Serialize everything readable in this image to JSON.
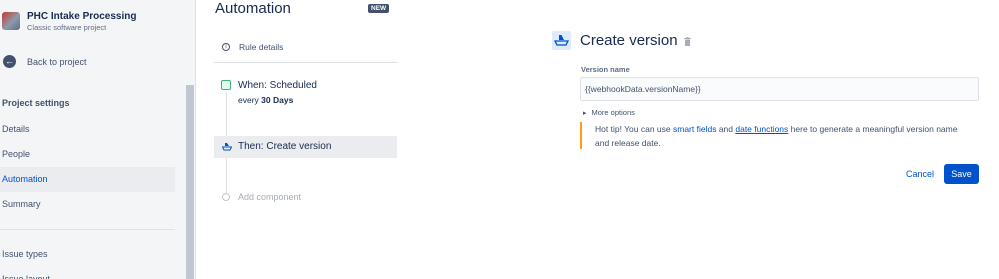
{
  "project": {
    "name": "PHC Intake Processing",
    "type": "Classic software project"
  },
  "sidebar": {
    "back_label": "Back to project",
    "section_title": "Project settings",
    "items": [
      {
        "label": "Details"
      },
      {
        "label": "People"
      },
      {
        "label": "Automation"
      },
      {
        "label": "Summary"
      },
      {
        "label": "Issue types"
      },
      {
        "label": "Issue layout"
      }
    ]
  },
  "rule_panel": {
    "title": "Automation",
    "badge": "NEW",
    "rule_details": "Rule details",
    "trigger": {
      "title": "When: Scheduled",
      "prefix": "every ",
      "value": "30 Days"
    },
    "action": "Then: Create version",
    "add_component": "Add component"
  },
  "form": {
    "title": "Create version",
    "version_name_label": "Version name",
    "version_name_value": "{{webhookData.versionName}}",
    "more_options": "More options",
    "tip": {
      "prefix": "Hot tip! You can use ",
      "link1": "smart fields",
      "middle": " and ",
      "link2": "date functions",
      "suffix": " here to generate a meaningful version name and release date."
    },
    "cancel_label": "Cancel",
    "save_label": "Save"
  },
  "colors": {
    "brand": "#0052CC",
    "tip_border": "#FF991F",
    "trigger_icon": "#36B37E"
  },
  "icons": [
    "back-arrow-icon",
    "info-icon",
    "calendar-icon",
    "ship-icon",
    "trash-icon",
    "chevron-right-icon"
  ]
}
